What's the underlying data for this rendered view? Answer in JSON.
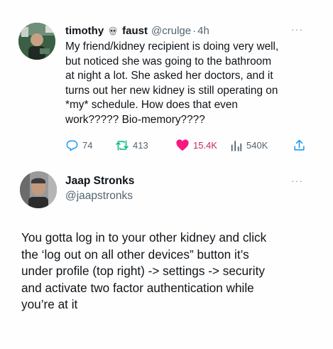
{
  "tweet1": {
    "display_name": "timothy",
    "display_name_2": "faust",
    "handle": "@crulge",
    "separator": "·",
    "time": "4h",
    "more_label": "···",
    "body": "My friend/kidney recipient is doing very well,\nbut noticed she was going to the bathroom\nat night a lot. She asked her doctors, and it\nturns out her new kidney is still operating on\n*my* schedule. How does that even\nwork????? Bio-memory????",
    "actions": {
      "replies": "74",
      "retweets": "413",
      "likes": "15.4K",
      "views": "540K"
    }
  },
  "tweet2": {
    "display_name": "Jaap Stronks",
    "handle": "@jaapstronks",
    "more_label": "···",
    "body": "You gotta log in to your other kidney and click\nthe ‘log out on all other devices” button it’s\nunder profile (top right) -> settings -> security\nand activate two factor authentication while\nyou’re at it"
  },
  "colors": {
    "muted": "#536471",
    "like": "#f91880"
  }
}
